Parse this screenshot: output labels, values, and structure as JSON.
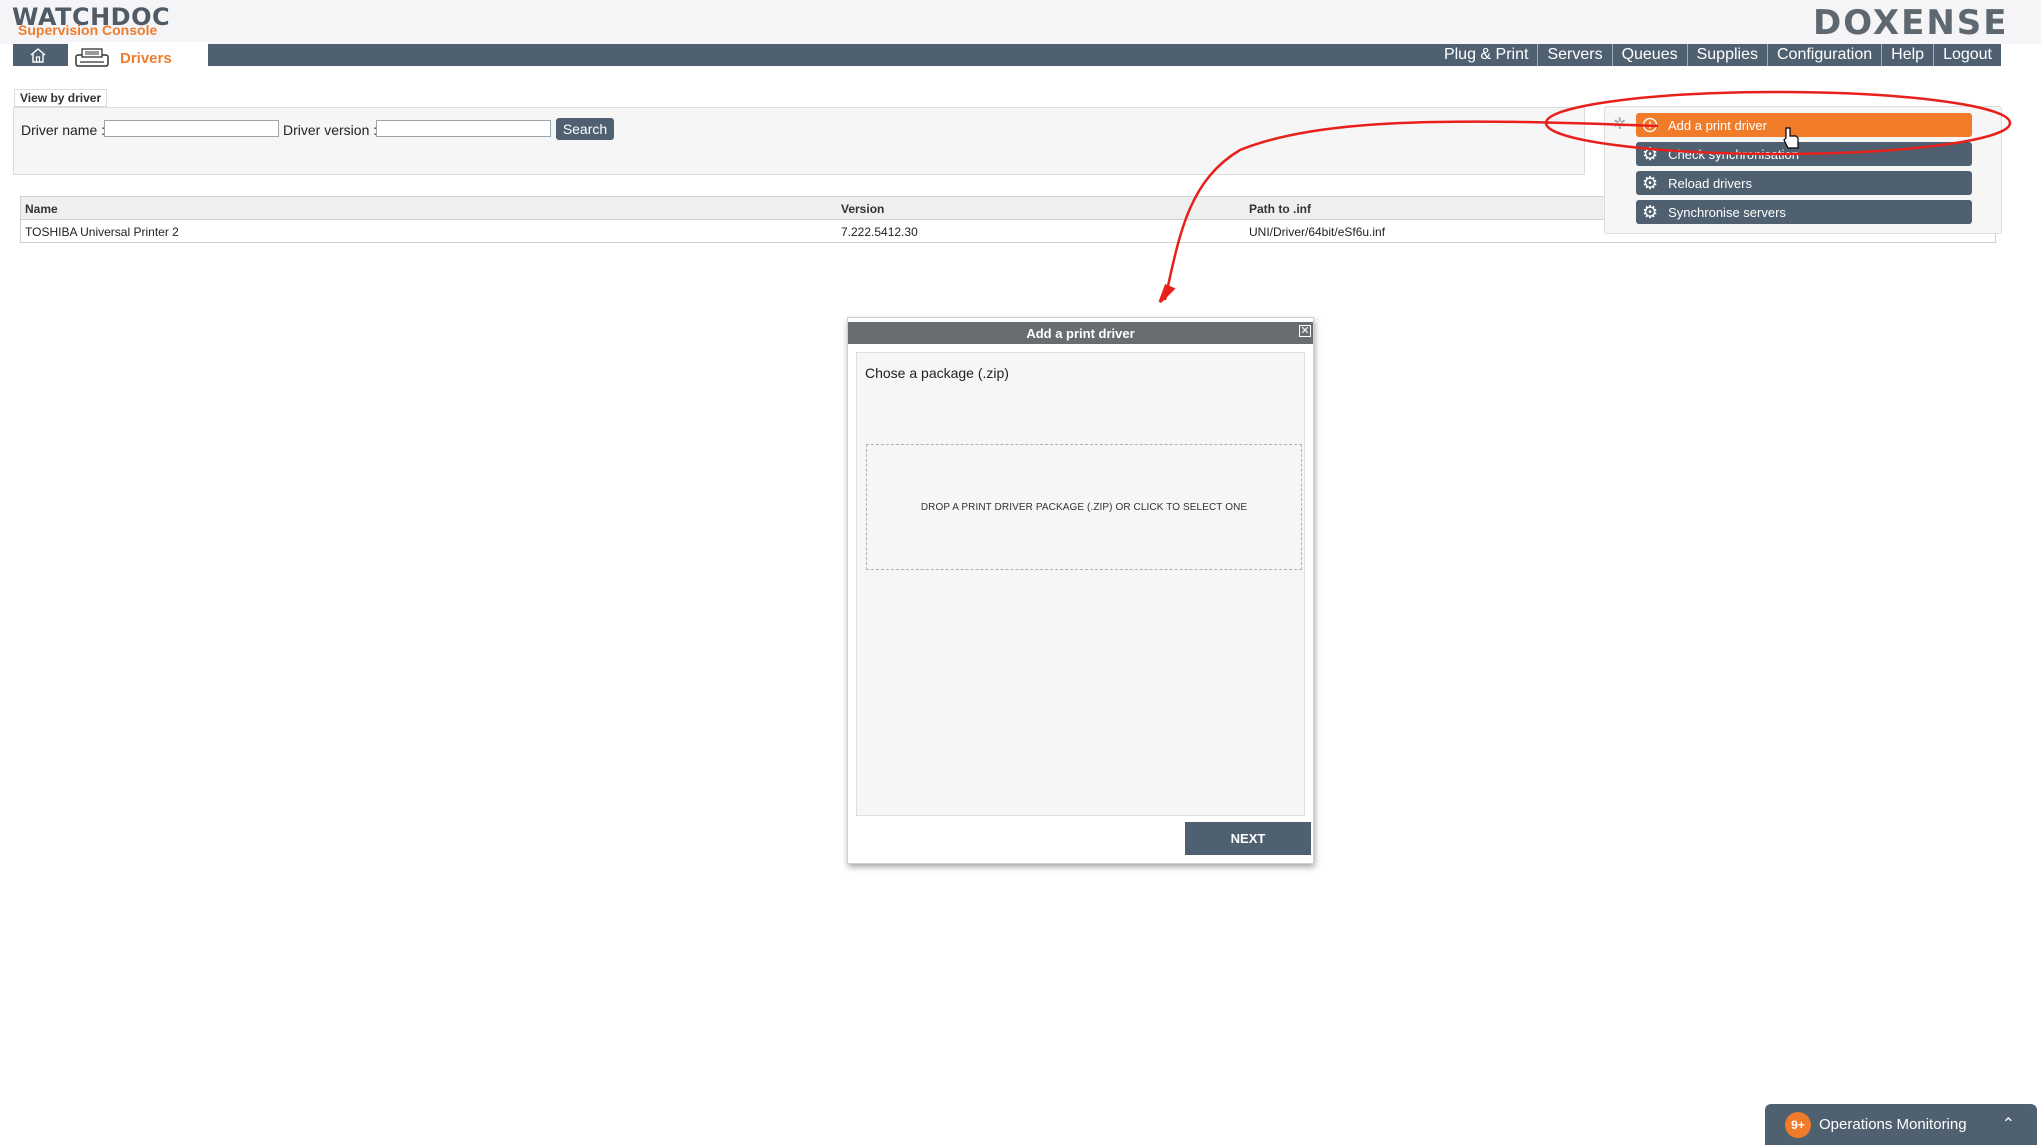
{
  "header": {
    "app_logo": "WATCHDOC",
    "app_subtitle": "Supervision Console",
    "brand_logo": "DOXENSE"
  },
  "nav": {
    "current_tab": "Drivers",
    "menu": [
      "Plug & Print",
      "Servers",
      "Queues",
      "Supplies",
      "Configuration",
      "Help",
      "Logout"
    ]
  },
  "filter": {
    "legend": "View by driver",
    "driver_name_label": "Driver name :",
    "driver_name_value": "",
    "driver_version_label": "Driver version :",
    "driver_version_value": "",
    "search_label": "Search"
  },
  "table": {
    "columns": [
      "Name",
      "Version",
      "Path to .inf"
    ],
    "rows": [
      {
        "name": "TOSHIBA Universal Printer 2",
        "version": "7.222.5412.30",
        "path": "UNI/Driver/64bit/eSf6u.inf"
      }
    ]
  },
  "actions": {
    "add_print_driver": "Add a print driver",
    "check_sync": "Check synchronisation",
    "reload_drivers": "Reload drivers",
    "sync_servers": "Synchronise servers"
  },
  "modal": {
    "title": "Add a print driver",
    "prompt": "Chose a package (.zip)",
    "dropzone_text": "DROP A PRINT DRIVER PACKAGE (.ZIP) OR CLICK TO SELECT ONE",
    "next_label": "NEXT"
  },
  "ops_monitoring": {
    "badge": "9+",
    "label": "Operations Monitoring"
  },
  "colors": {
    "brand_orange": "#f07c2a",
    "nav_slate": "#4f6170",
    "annotation_red": "#e8201b",
    "doxense_green": "#2fb28a"
  }
}
